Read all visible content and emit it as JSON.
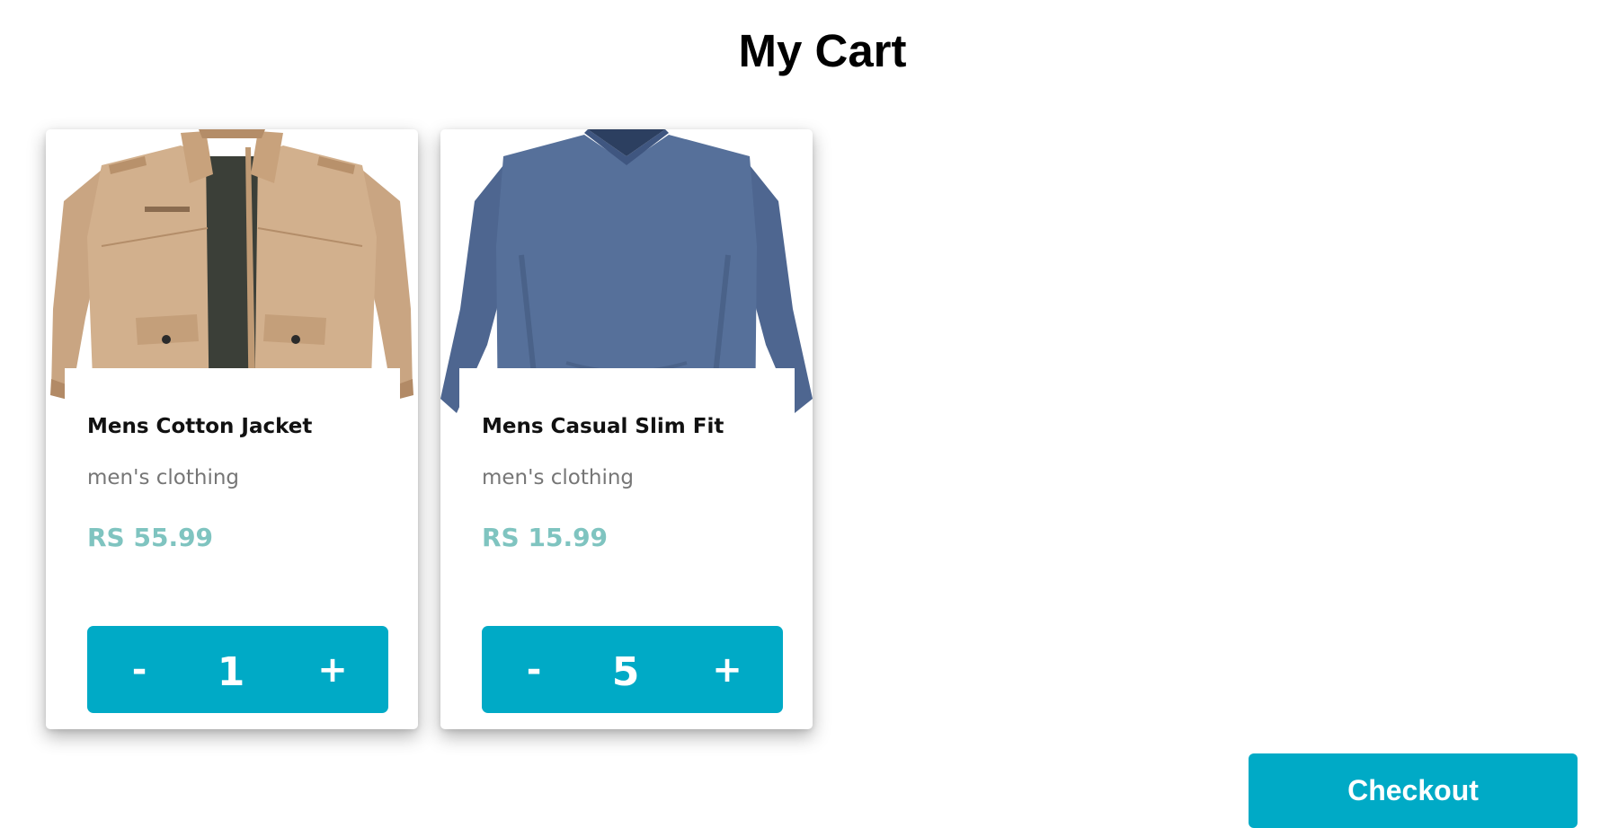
{
  "page": {
    "title": "My Cart"
  },
  "cart": {
    "items": [
      {
        "name": "Mens Cotton Jacket",
        "category": "men's clothing",
        "price": "RS 55.99",
        "quantity": "1",
        "minus_label": "-",
        "plus_label": "+",
        "image": "tan-cotton-jacket-image"
      },
      {
        "name": "Mens Casual Slim Fit",
        "category": "men's clothing",
        "price": "RS 15.99",
        "quantity": "5",
        "minus_label": "-",
        "plus_label": "+",
        "image": "blue-long-sleeve-shirt-image"
      }
    ]
  },
  "checkout": {
    "label": "Checkout"
  },
  "colors": {
    "accent": "#00aac6",
    "price": "#7fc4c0",
    "category": "#767676"
  }
}
